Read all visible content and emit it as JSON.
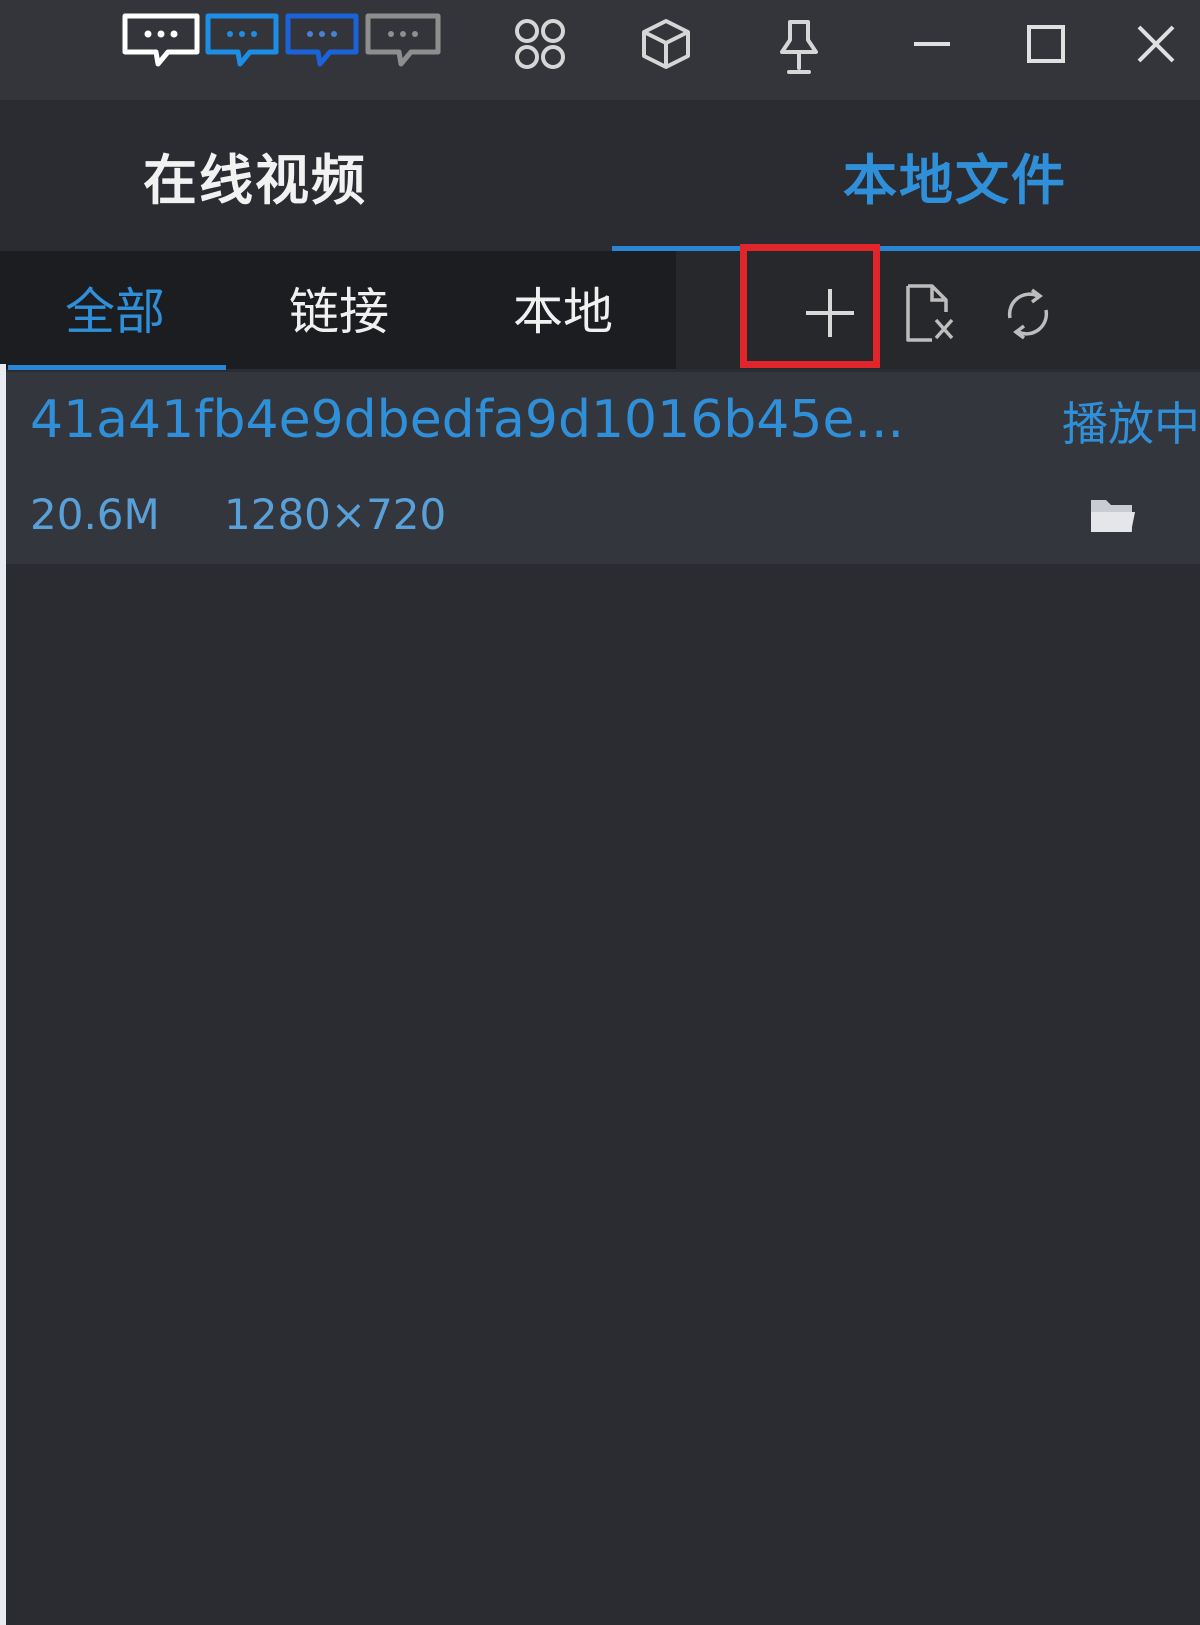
{
  "titlebar": {
    "icons": [
      "danmaku-white-icon",
      "danmaku-blue-icon",
      "danmaku-blue-dark-icon",
      "danmaku-gray-icon",
      "apps-icon",
      "box-icon",
      "pin-icon",
      "minimize-icon",
      "maximize-icon",
      "close-icon"
    ]
  },
  "main_tabs": [
    {
      "label": "在线视频",
      "active": false
    },
    {
      "label": "本地文件",
      "active": true
    }
  ],
  "sub_tabs": [
    {
      "label": "全部",
      "active": true
    },
    {
      "label": "链接",
      "active": false
    },
    {
      "label": "本地",
      "active": false
    }
  ],
  "tools": [
    "add-icon",
    "delete-file-icon",
    "refresh-icon"
  ],
  "file_list": [
    {
      "name": "41a41fb4e9dbedfa9d1016b45e...",
      "status": "播放中",
      "size": "20.6M",
      "resolution": "1280×720"
    }
  ],
  "colors": {
    "accent": "#2f8fd8",
    "background": "#2b2c31",
    "highlight": "#e0262b"
  }
}
